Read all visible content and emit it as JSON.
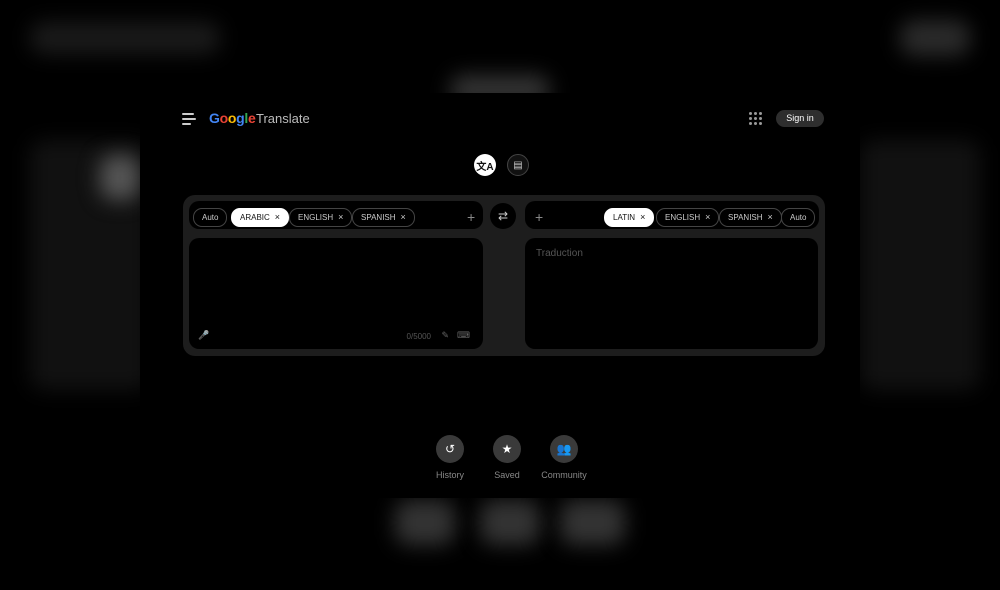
{
  "header": {
    "logo_letters": [
      "G",
      "o",
      "o",
      "g",
      "l",
      "e"
    ],
    "product_name": "Translate",
    "signin_label": "Sign in"
  },
  "modes": [
    {
      "name": "text",
      "icon": "translate-icon"
    },
    {
      "name": "document",
      "icon": "document-icon"
    }
  ],
  "source": {
    "chips": [
      {
        "label": "Auto",
        "active": false,
        "removable": false
      },
      {
        "label": "ARABIC",
        "active": true,
        "removable": true
      },
      {
        "label": "ENGLISH",
        "active": false,
        "removable": true
      },
      {
        "label": "SPANISH",
        "active": false,
        "removable": true
      }
    ],
    "counter": "0/5000"
  },
  "target": {
    "chips": [
      {
        "label": "LATIN",
        "active": true,
        "removable": true
      },
      {
        "label": "ENGLISH",
        "active": false,
        "removable": true
      },
      {
        "label": "SPANISH",
        "active": false,
        "removable": true
      },
      {
        "label": "Auto",
        "active": false,
        "removable": false
      }
    ],
    "placeholder": "Traduction"
  },
  "bottom_nav": [
    {
      "label": "History",
      "icon": "history-icon"
    },
    {
      "label": "Saved",
      "icon": "star-icon"
    },
    {
      "label": "Community",
      "icon": "community-icon"
    }
  ],
  "icons": {
    "close": "×",
    "plus": "+",
    "swap": "⇄"
  },
  "colors": {
    "accent_blue": "#4285f4",
    "red": "#ea4335",
    "yellow": "#fbbc05",
    "green": "#34a853"
  }
}
